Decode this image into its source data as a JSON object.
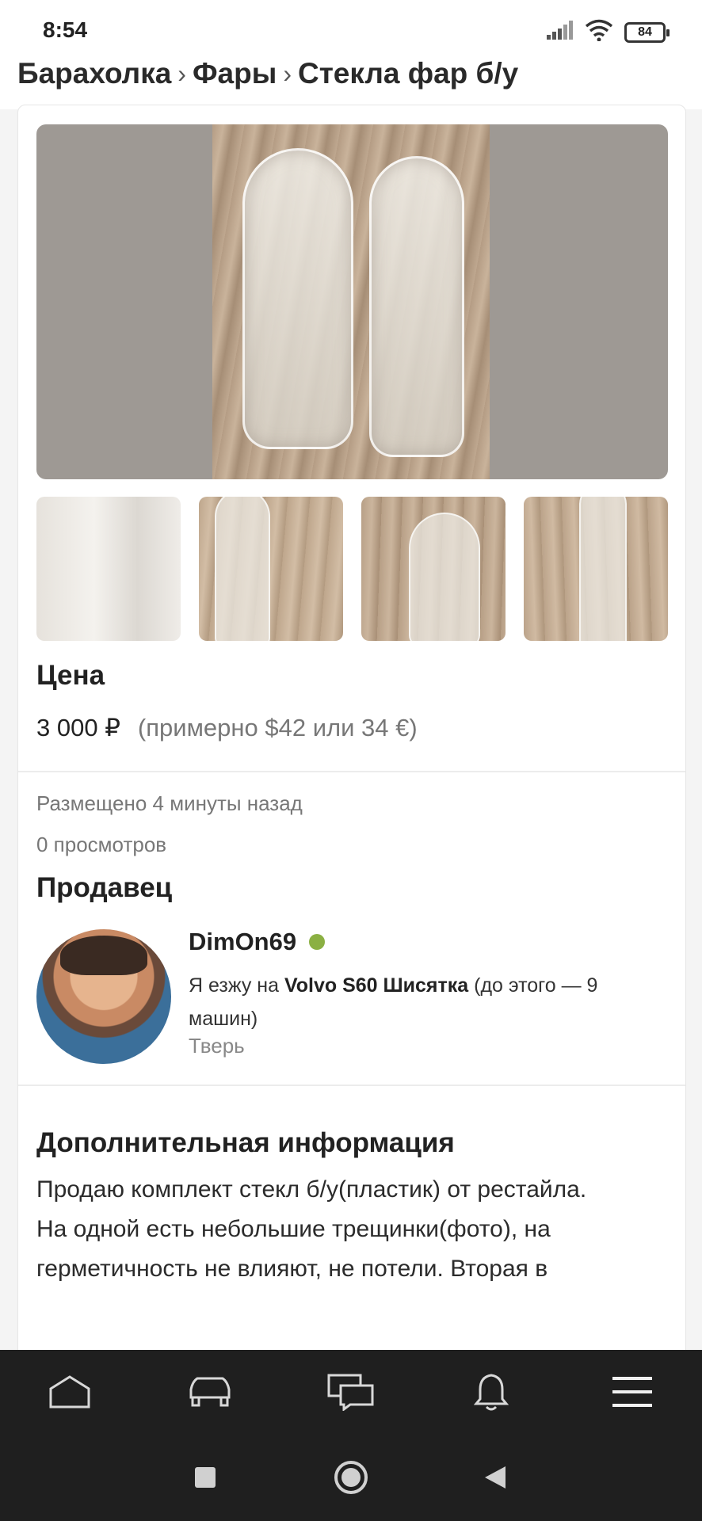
{
  "status_bar": {
    "time": "8:54",
    "battery": "84"
  },
  "breadcrumb": {
    "items": [
      "Барахолка",
      "Фары",
      "Стекла фар б/у"
    ],
    "separator": "›"
  },
  "price": {
    "title": "Цена",
    "value": "3 000 ₽",
    "approx": "(примерно $42 или 34 €)"
  },
  "meta": {
    "posted": "Размещено 4 минуты назад",
    "views": "0 просмотров"
  },
  "seller": {
    "title": "Продавец",
    "name": "DimOn69",
    "car_prefix": "Я езжу на ",
    "car_name": "Volvo S60 Шисятка",
    "car_suffix": " (до этого — 9 машин)",
    "city": "Тверь",
    "online_color": "#8bb043"
  },
  "info": {
    "title": "Дополнительная информация",
    "line1": "Продаю комплект стекл б/у(пластик) от рестайла.",
    "line2": "На одной есть небольшие трещинки(фото), на герметичность не влияют, не потели. Вторая в"
  },
  "nav": {
    "items": [
      "home-icon",
      "car-icon",
      "messages-icon",
      "bell-icon",
      "menu-icon"
    ]
  },
  "system_nav": {
    "items": [
      "recent-apps-icon",
      "home-circle-icon",
      "back-icon"
    ]
  }
}
